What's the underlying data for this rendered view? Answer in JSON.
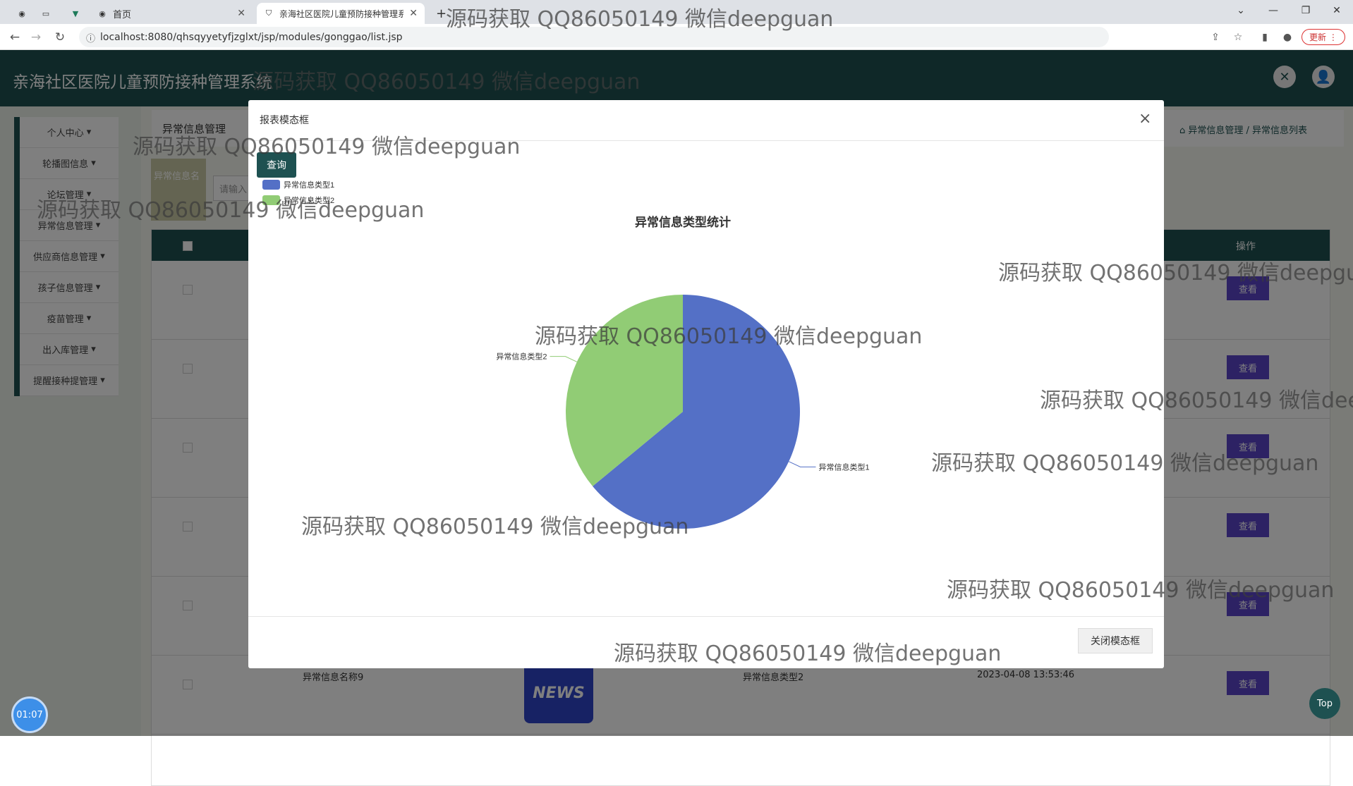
{
  "browser": {
    "tabs": [
      {
        "label": "首页",
        "active": false
      },
      {
        "label": "亲海社区医院儿童预防接种管理系",
        "active": true
      }
    ],
    "url": "localhost:8080/qhsqyyetyfjzglxt/jsp/modules/gonggao/list.jsp",
    "update_label": "更新"
  },
  "app": {
    "title": "亲海社区医院儿童预防接种管理系统",
    "sidebar": [
      {
        "label": "个人中心"
      },
      {
        "label": "轮播图信息"
      },
      {
        "label": "论坛管理"
      },
      {
        "label": "异常信息管理"
      },
      {
        "label": "供应商信息管理"
      },
      {
        "label": "孩子信息管理"
      },
      {
        "label": "疫苗管理"
      },
      {
        "label": "出入库管理"
      },
      {
        "label": "提醒接种提管理"
      }
    ],
    "breadcrumb_title": "异常信息管理",
    "breadcrumb_path": "异常信息管理 / 异常信息列表",
    "search_label": "异常信息名",
    "search_placeholder": "请输入",
    "table": {
      "operation_header": "操作",
      "view_label": "查看",
      "last_row": {
        "name": "异常信息名称9",
        "type": "异常信息类型2",
        "time": "2023-04-08 13:53:46",
        "image_text": "NEWS"
      }
    }
  },
  "modal": {
    "title": "报表模态框",
    "query_label": "查询",
    "close_label": "关闭模态框"
  },
  "chart_data": {
    "type": "pie",
    "title": "异常信息类型统计",
    "legend_position": "top-left",
    "categories": [
      "异常信息类型1",
      "异常信息类型2"
    ],
    "values": [
      64,
      36
    ],
    "colors": [
      "#5470c6",
      "#91cc75"
    ]
  },
  "overlay": {
    "timer": "01:07",
    "top_label": "Top"
  },
  "watermark_text": "源码获取 QQ86050149 微信deepguan"
}
